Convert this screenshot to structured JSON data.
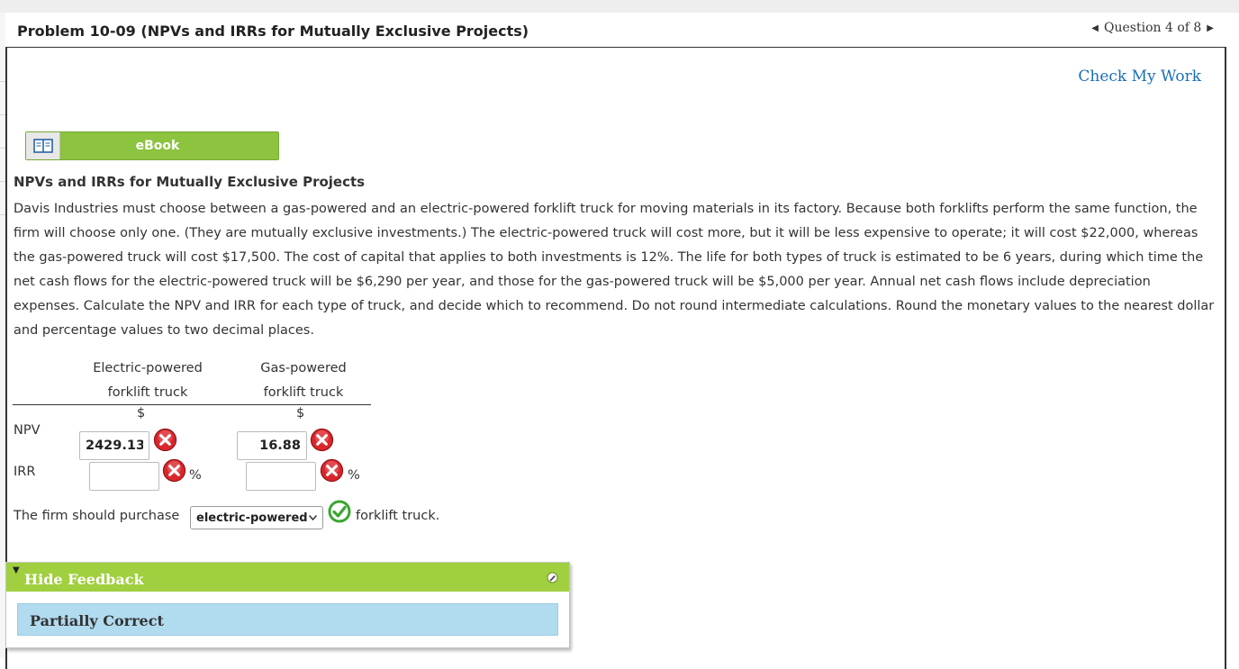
{
  "header": {
    "title": "Problem 10-09 (NPVs and IRRs for Mutually Exclusive Projects)",
    "question_nav": "Question 4 of 8"
  },
  "actions": {
    "check_my_work": "Check My Work",
    "ebook": "eBook"
  },
  "problem": {
    "section_title": "NPVs and IRRs for Mutually Exclusive Projects",
    "text": "Davis Industries must choose between a gas-powered and an electric-powered forklift truck for moving materials in its factory. Because both forklifts perform the same function, the firm will choose only one. (They are mutually exclusive investments.) The electric-powered truck will cost more, but it will be less expensive to operate; it will cost $22,000, whereas the gas-powered truck will cost $17,500. The cost of capital that applies to both investments is 12%. The life for both types of truck is estimated to be 6 years, during which time the net cash flows for the electric-powered truck will be $6,290 per year, and those for the gas-powered truck will be $5,000 per year. Annual net cash flows include depreciation expenses. Calculate the NPV and IRR for each type of truck, and decide which to recommend. Do not round intermediate calculations. Round the monetary values to the nearest dollar and percentage values to two decimal places."
  },
  "table": {
    "col1_line1": "Electric-powered",
    "col1_line2": "forklift truck",
    "col2_line1": "Gas-powered",
    "col2_line2": "forklift truck",
    "currency": "$",
    "percent": "%",
    "row_npv": "NPV",
    "row_irr": "IRR",
    "npv_electric": "2429.13",
    "npv_gas": "16.88",
    "irr_electric": "",
    "irr_gas": ""
  },
  "recommendation": {
    "prefix": "The firm should purchase",
    "selected": "electric-powered",
    "suffix": "forklift truck."
  },
  "feedback": {
    "toggle_label": "Hide Feedback",
    "status": "Partially Correct"
  },
  "colors": {
    "accent_green": "#8cc33f",
    "feedback_green": "#a0cf3f",
    "feedback_blue": "#b1dbef",
    "link_blue": "#1a6fb5",
    "error_red": "#d9262c",
    "correct_green": "#3aa62e"
  }
}
